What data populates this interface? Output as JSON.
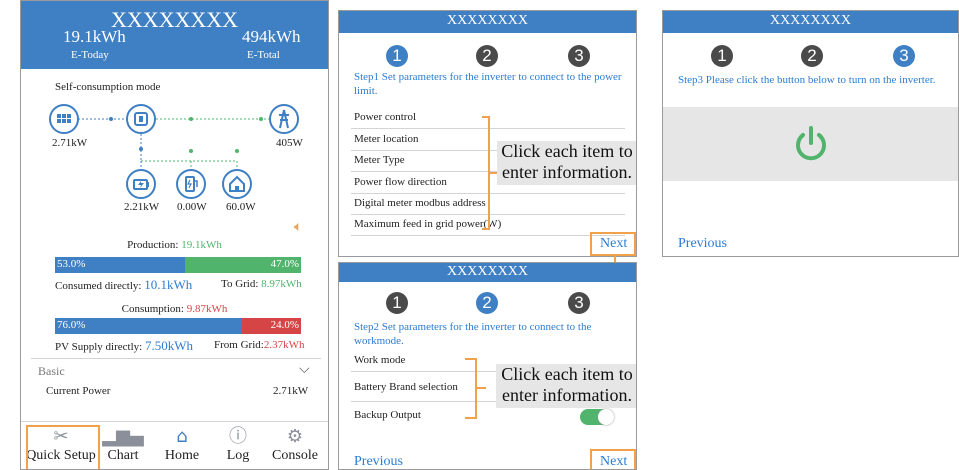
{
  "app": {
    "title": "XXXXXXXX",
    "e_today_value": "19.1kWh",
    "e_today_label": "E-Today",
    "e_total_value": "494kWh",
    "e_total_label": "E-Total",
    "mode": "Self-consumption mode",
    "pv_power": "2.71kW",
    "grid_power": "405W",
    "battery_power": "2.21kW",
    "ev_power": "0.00W",
    "home_power": "60.0W",
    "production_label": "Production: ",
    "production_value": "19.1kWh",
    "production_bar": {
      "left_pct": "53.0%",
      "right_pct": "47.0%",
      "left_fraction": 0.53
    },
    "consumed_directly_label": "Consumed directly: ",
    "consumed_directly_value": "10.1kWh",
    "to_grid_label": "To Grid: ",
    "to_grid_value": "8.97kWh",
    "consumption_label": "Consumption: ",
    "consumption_value": "9.87kWh",
    "consumption_bar": {
      "left_pct": "76.0%",
      "right_pct": "24.0%",
      "left_fraction": 0.76
    },
    "pv_supply_label": "PV Supply directly: ",
    "pv_supply_value": "7.50kWh",
    "from_grid_label": "From Grid:",
    "from_grid_value": "2.37kWh",
    "basic_label": "Basic",
    "current_power_label": "Current Power",
    "current_power_value": "2.71kW",
    "nav": [
      "Quick Setup",
      "Chart",
      "Home",
      "Log",
      "Console"
    ]
  },
  "step1": {
    "title": "XXXXXXXX",
    "steps": [
      "1",
      "2",
      "3"
    ],
    "instruction": "Step1 Set parameters for the inverter to connect to the power limit.",
    "items": [
      "Power control",
      "Meter location",
      "Meter Type",
      "Power flow direction",
      "Digital meter modbus address",
      "Maximum feed in grid power(W)"
    ],
    "callout": "Click each item to enter information.",
    "next": "Next"
  },
  "step2": {
    "title": "XXXXXXXX",
    "steps": [
      "1",
      "2",
      "3"
    ],
    "instruction": "Step2 Set parameters for the inverter to connect to the workmode.",
    "items": [
      "Work mode",
      "Battery Brand selection",
      "Backup Output"
    ],
    "callout": "Click each item to enter information.",
    "previous": "Previous",
    "next": "Next"
  },
  "step3": {
    "title": "XXXXXXXX",
    "steps": [
      "1",
      "2",
      "3"
    ],
    "instruction": "Step3 Please click the button below to turn on the inverter.",
    "previous": "Previous"
  },
  "colors": {
    "header_blue": "#3f7fc4",
    "green": "#51b46c",
    "red": "#d64545",
    "orange": "#f0a14c"
  }
}
